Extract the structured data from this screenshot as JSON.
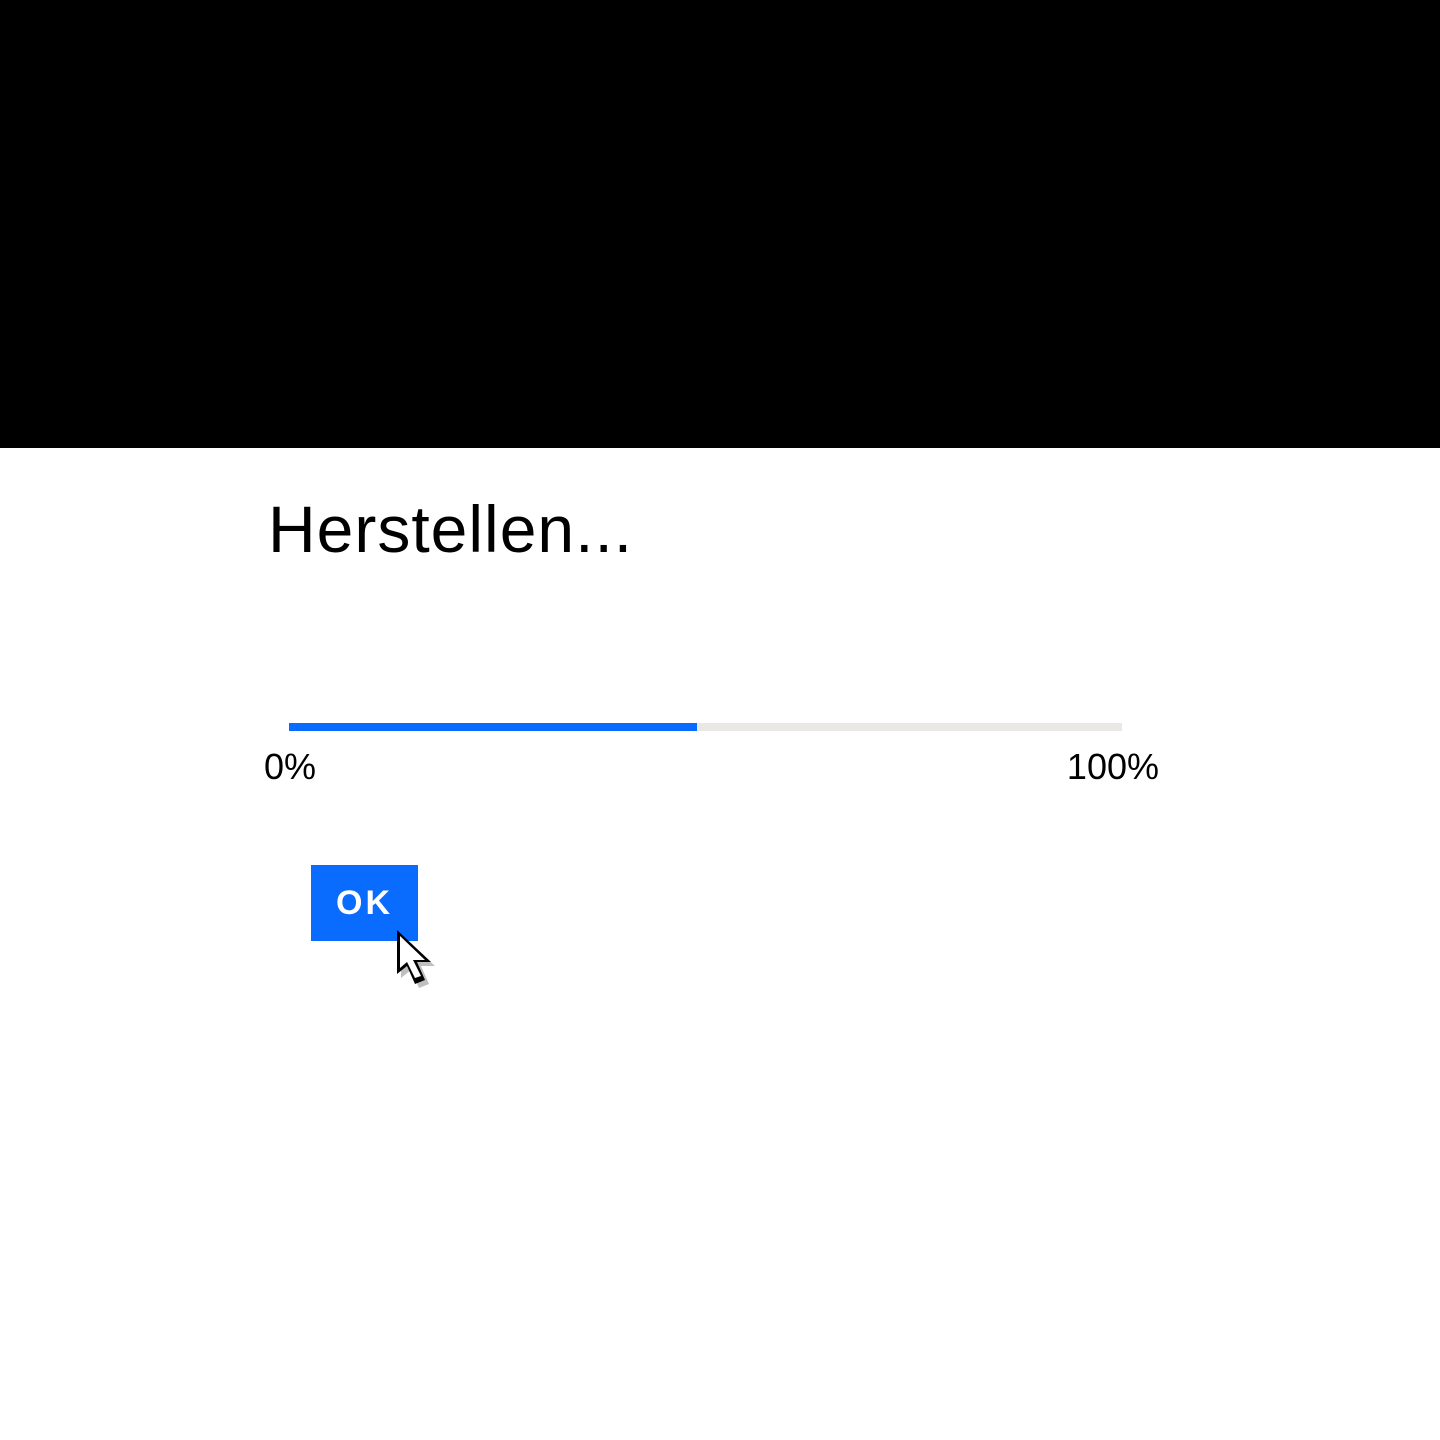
{
  "dialog": {
    "title": "Herstellen...",
    "progress": {
      "percent": 49,
      "label_start": "0%",
      "label_end": "100%"
    },
    "ok_label": "OK"
  },
  "colors": {
    "accent": "#0a6cff",
    "track": "#eae8e4"
  }
}
